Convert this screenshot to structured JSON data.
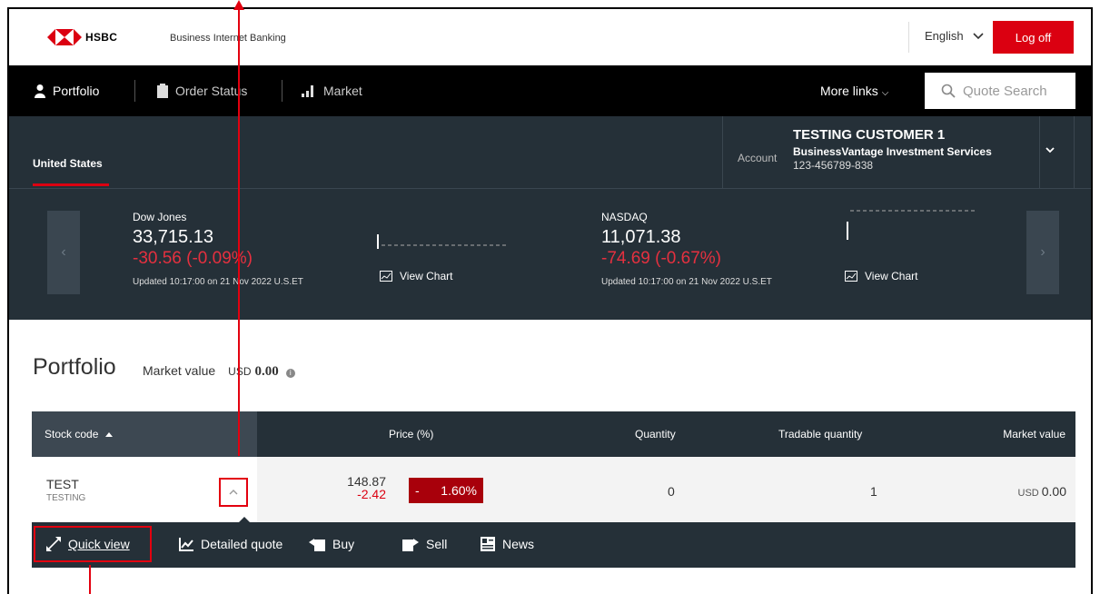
{
  "header": {
    "brand": "HSBC",
    "subtitle": "Business Internet Banking",
    "language": "English",
    "logoff_label": "Log off"
  },
  "nav": {
    "items": [
      {
        "label": "Portfolio",
        "icon": "person-icon"
      },
      {
        "label": "Order Status",
        "icon": "clipboard-icon"
      },
      {
        "label": "Market",
        "icon": "bar-chart-icon"
      }
    ],
    "more_links": "More links",
    "quote_search_placeholder": "Quote Search"
  },
  "account": {
    "tab": "United States",
    "label": "Account",
    "customer_name": "TESTING CUSTOMER 1",
    "service": "BusinessVantage Investment Services",
    "number": "123-456789-838"
  },
  "indices": [
    {
      "name": "Dow Jones",
      "value": "33,715.13",
      "change": "-30.56 (-0.09%)",
      "updated": "Updated 10:17:00 on 21 Nov 2022 U.S.ET",
      "view_chart": "View Chart"
    },
    {
      "name": "NASDAQ",
      "value": "11,071.38",
      "change": "-74.69 (-0.67%)",
      "updated": "Updated 10:17:00 on 21 Nov 2022 U.S.ET",
      "view_chart": "View Chart"
    }
  ],
  "portfolio": {
    "title": "Portfolio",
    "market_value_label": "Market value",
    "market_value_currency": "USD",
    "market_value": "0.00",
    "columns": [
      "Stock code",
      "Price (%)",
      "Quantity",
      "Tradable quantity",
      "Market value"
    ],
    "rows": [
      {
        "code": "TEST",
        "name": "TESTING",
        "price": "148.87",
        "price_change": "-2.42",
        "pct_sign": "-",
        "pct": "1.60%",
        "quantity": "0",
        "tradable_quantity": "1",
        "market_value_currency": "USD",
        "market_value": "0.00"
      }
    ],
    "actions": [
      "Quick view",
      "Detailed quote",
      "Buy",
      "Sell",
      "News"
    ]
  },
  "colors": {
    "brand_red": "#db0011",
    "dark_navy": "#253038",
    "annotation_red": "#e3000f"
  }
}
